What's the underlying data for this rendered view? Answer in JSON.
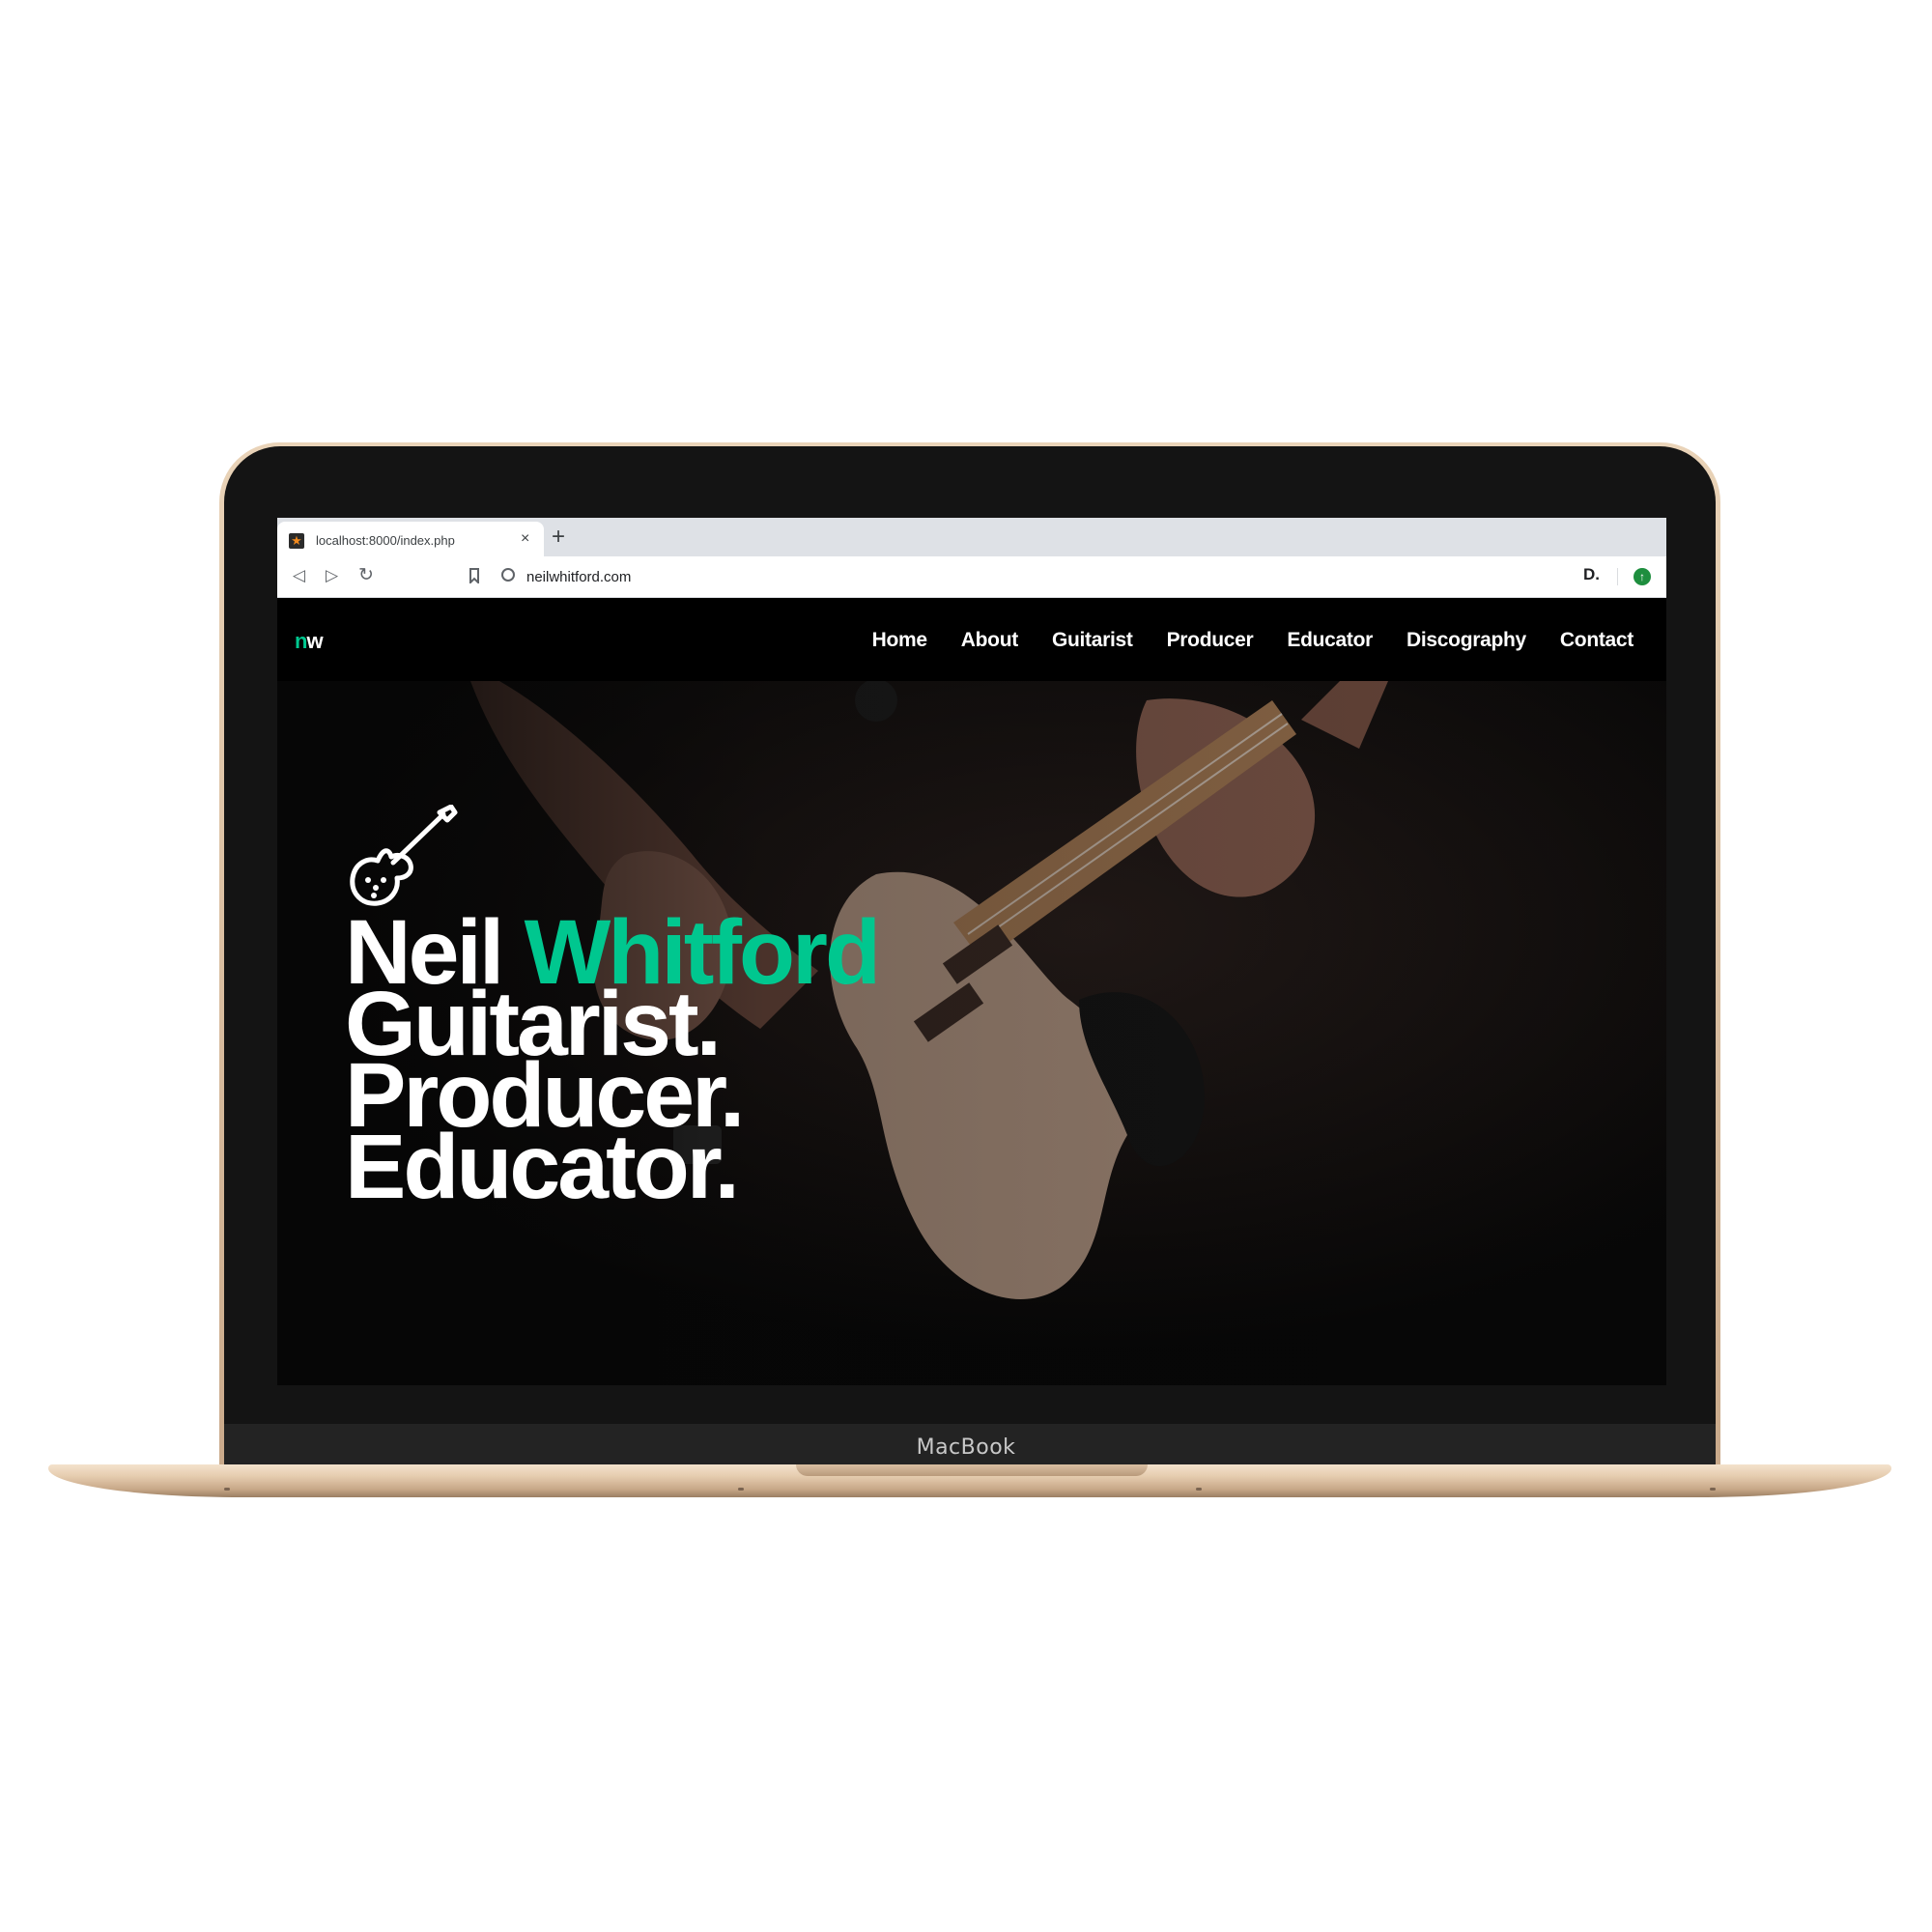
{
  "device": {
    "label": "MacBook"
  },
  "browser": {
    "tab": {
      "title": "localhost:8000/index.php",
      "close": "×",
      "favicon": "★"
    },
    "new_tab": "+",
    "nav": {
      "back": "◁",
      "forward": "▷",
      "reload": "↻",
      "bookmark": "⌂"
    },
    "url": "neilwhitford.com",
    "extensions": {
      "d_label": "D.",
      "green_label": "↑"
    }
  },
  "site": {
    "logo": {
      "n": "n",
      "w": "w"
    },
    "menu": [
      "Home",
      "About",
      "Guitarist",
      "Producer",
      "Educator",
      "Discography",
      "Contact"
    ],
    "hero": {
      "name_first": "Neil",
      "name_last": "Whitford",
      "line2": "Guitarist.",
      "line3": "Producer.",
      "line4": "Educator."
    },
    "accent_color": "#00c78f"
  }
}
